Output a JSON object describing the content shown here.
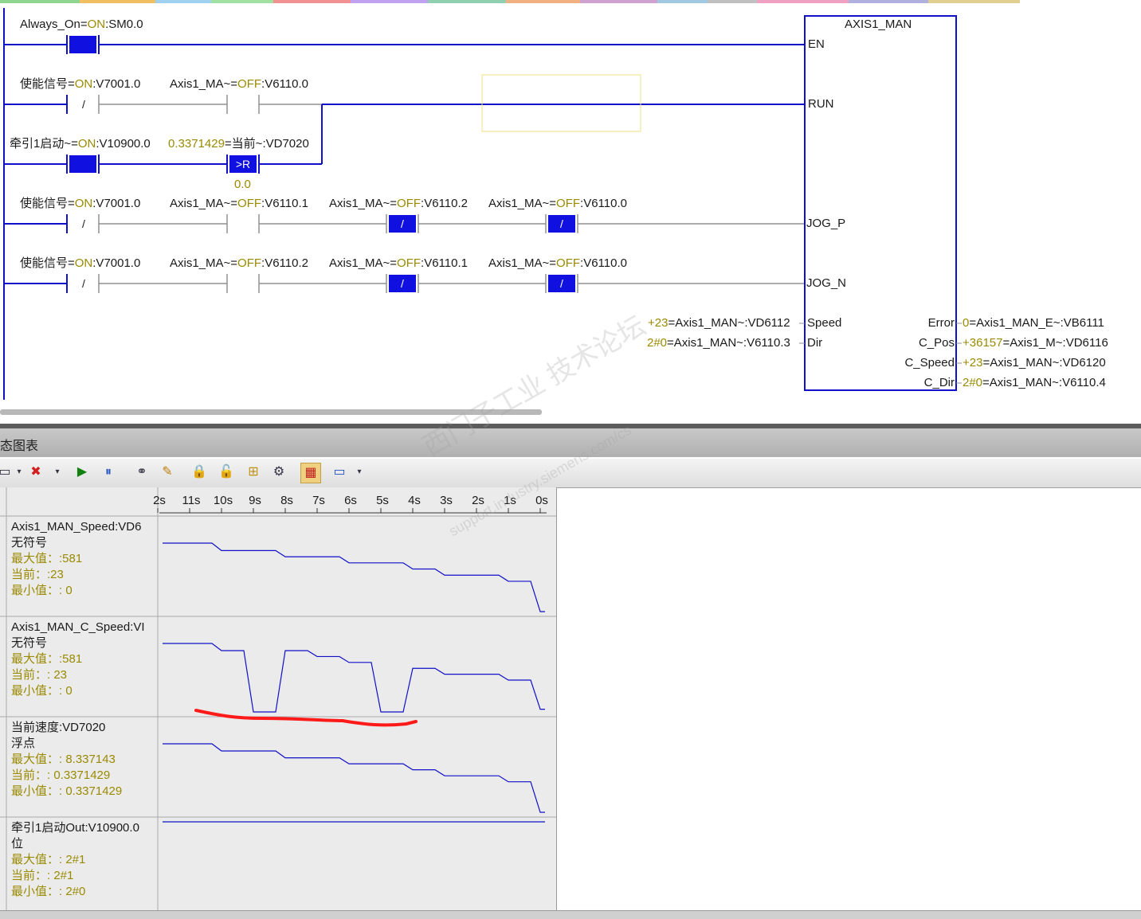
{
  "ladder": {
    "block_title": "AXIS1_MAN",
    "pins_left": [
      "EN",
      "RUN",
      "JOG_P",
      "JOG_N",
      "Speed",
      "Dir"
    ],
    "pins_right": [
      "Error",
      "C_Pos",
      "C_Speed",
      "C_Dir"
    ],
    "net1": {
      "name": "Always_On=",
      "state": "ON",
      "addr": ":SM0.0"
    },
    "net2": {
      "c1": {
        "name": "使能信号=",
        "state": "ON",
        "addr": ":V7001.0"
      },
      "c2": {
        "name": "Axis1_MA~=",
        "state": "OFF",
        "addr": ":V6110.0"
      }
    },
    "net3": {
      "c1": {
        "name": "牵引1启动~=",
        "state": "ON",
        "addr": ":V10900.0"
      },
      "cmp": {
        "value": "0.3371429",
        "name": "=当前~",
        "addr": ":VD7020",
        "op": ">R",
        "ref": "0.0"
      }
    },
    "net4": {
      "c1": {
        "name": "使能信号=",
        "state": "ON",
        "addr": ":V7001.0"
      },
      "c2": {
        "name": "Axis1_MA~=",
        "state": "OFF",
        "addr": ":V6110.1"
      },
      "c3": {
        "name": "Axis1_MA~=",
        "state": "OFF",
        "addr": ":V6110.2"
      },
      "c4": {
        "name": "Axis1_MA~=",
        "state": "OFF",
        "addr": ":V6110.0"
      }
    },
    "net5": {
      "c1": {
        "name": "使能信号=",
        "state": "ON",
        "addr": ":V7001.0"
      },
      "c2": {
        "name": "Axis1_MA~=",
        "state": "OFF",
        "addr": ":V6110.2"
      },
      "c3": {
        "name": "Axis1_MA~=",
        "state": "OFF",
        "addr": ":V6110.1"
      },
      "c4": {
        "name": "Axis1_MA~=",
        "state": "OFF",
        "addr": ":V6110.0"
      }
    },
    "nc_symbol": "/",
    "speed_in": {
      "val": "+23",
      "tag": "=Axis1_MAN~:VD6112"
    },
    "dir_in": {
      "val": "2#0",
      "tag": "=Axis1_MAN~:V6110.3"
    },
    "error_out": {
      "val": "0",
      "tag": "=Axis1_MAN_E~:VB6111"
    },
    "cpos_out": {
      "val": "+36157",
      "tag": "=Axis1_M~:VD6116"
    },
    "cspeed_out": {
      "val": "+23",
      "tag": "=Axis1_MAN~:VD6120"
    },
    "cdir_out": {
      "val": "2#0",
      "tag": "=Axis1_MAN~:V6110.4"
    }
  },
  "panel": {
    "title": "态图表",
    "watermark": "西门子工业 技术论坛",
    "watermark_url": "support.industry.siemens.com/cs"
  },
  "trend": {
    "time_axis": [
      "2s",
      "11s",
      "10s",
      "9s",
      "8s",
      "7s",
      "6s",
      "5s",
      "4s",
      "3s",
      "2s",
      "1s",
      "0s"
    ],
    "rows": [
      {
        "name": "Axis1_MAN_Speed:VD6",
        "type": "无符号",
        "max_label": "最大值：",
        "max": ":581",
        "cur_label": "当前：",
        "cur": ":23",
        "min_label": "最小值：",
        "min": ": 0"
      },
      {
        "name": "Axis1_MAN_C_Speed:VI",
        "type": "无符号",
        "max_label": "最大值：",
        "max": ":581",
        "cur_label": "当前：",
        "cur": ": 23",
        "min_label": "最小值：",
        "min": ": 0"
      },
      {
        "name": "当前速度:VD7020",
        "type": "浮点",
        "max_label": "最大值：",
        "max": ": 8.337143",
        "cur_label": "当前：",
        "cur": ": 0.3371429",
        "min_label": "最小值：",
        "min": ": 0.3371429"
      },
      {
        "name": "牵引1启动Out:V10900.0",
        "type": "位",
        "max_label": "最大值：",
        "max": ": 2#1",
        "cur_label": "当前：",
        "cur": ": 2#1",
        "min_label": "最小值：",
        "min": ": 2#0"
      }
    ],
    "colors": {
      "trace": "#1010c8",
      "annotation": "#ff1a1a",
      "contact_on": "#1010e0",
      "rung": "#1010c8"
    }
  },
  "chart_data": {
    "type": "line",
    "x_unit": "s (time before now)",
    "x": [
      12,
      11,
      10,
      9,
      8,
      7,
      6,
      5,
      4,
      3,
      2,
      1,
      0
    ],
    "series": [
      {
        "name": "Axis1_MAN_Speed:VD6",
        "values": [
          581,
          581,
          520,
          520,
          470,
          470,
          420,
          420,
          370,
          320,
          320,
          270,
          23
        ]
      },
      {
        "name": "Axis1_MAN_C_Speed:VI",
        "values": [
          581,
          581,
          520,
          0,
          520,
          470,
          420,
          0,
          370,
          320,
          320,
          270,
          23
        ]
      },
      {
        "name": "当前速度:VD7020",
        "values": [
          8.337,
          8.337,
          7.5,
          7.5,
          6.7,
          6.7,
          6.0,
          6.0,
          5.3,
          4.6,
          4.6,
          3.9,
          0.337
        ]
      },
      {
        "name": "牵引1启动Out:V10900.0",
        "values": [
          1,
          1,
          1,
          1,
          1,
          1,
          1,
          1,
          1,
          1,
          1,
          1,
          1
        ]
      }
    ]
  }
}
